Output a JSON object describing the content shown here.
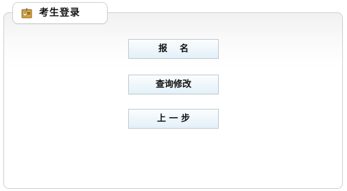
{
  "panel": {
    "tab_title": "考生登录",
    "tab_icon": "id-card-icon"
  },
  "buttons": {
    "register_label": "报    名",
    "modify_label": "查询修改",
    "back_label": "上 一 步"
  }
}
